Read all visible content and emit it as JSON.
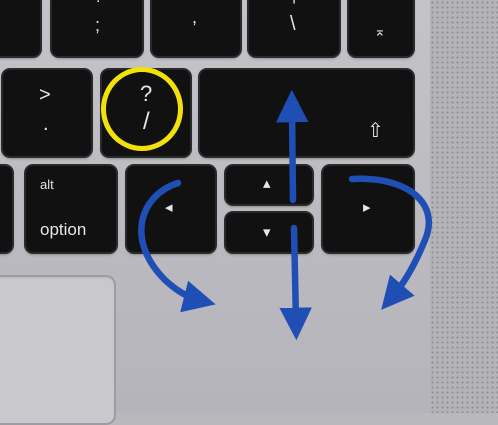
{
  "keys": {
    "semicolon": {
      "upper": ":",
      "lower": ";"
    },
    "quote": {
      "lower": ","
    },
    "pipe": {
      "upper": "|",
      "lower": "\\"
    },
    "question": {
      "upper": "?",
      "lower": "/"
    },
    "greater": {
      "upper": ">",
      "lower": "."
    },
    "option": {
      "upper": "alt",
      "lower": "option"
    },
    "arrow_left": "◂",
    "arrow_up": "▴",
    "arrow_down": "▾",
    "arrow_right": "▸",
    "shift": "⇧",
    "eject": "⌅"
  },
  "colors": {
    "highlight": "#f3e20a",
    "arrow": "#1f4fb4",
    "key": "#111112",
    "deck": "#c0c0c4"
  },
  "annotations": {
    "circle_target": "question-key",
    "arrows": [
      "up",
      "down",
      "left-curve",
      "right-curve"
    ]
  }
}
